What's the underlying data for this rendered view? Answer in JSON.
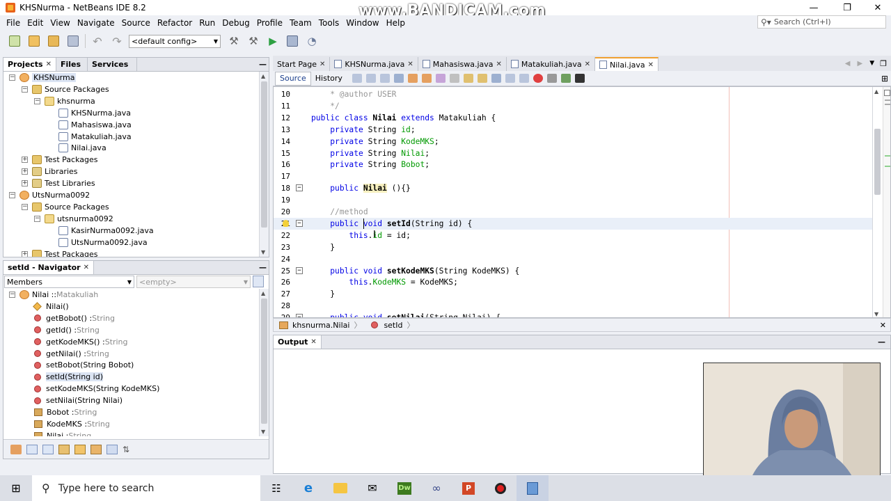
{
  "window": {
    "title": "KHSNurma - NetBeans IDE 8.2",
    "minimize": "—",
    "maximize": "❐",
    "close": "✕"
  },
  "watermark": "www.BANDICAM.com",
  "menu": [
    "File",
    "Edit",
    "View",
    "Navigate",
    "Source",
    "Refactor",
    "Run",
    "Debug",
    "Profile",
    "Team",
    "Tools",
    "Window",
    "Help"
  ],
  "search": {
    "placeholder": "Search (Ctrl+I)"
  },
  "toolbar": {
    "config": "<default config>"
  },
  "projects_panel": {
    "tabs": [
      "Projects",
      "Files",
      "Services"
    ],
    "tree": [
      {
        "label": "KHSNurma",
        "icon": "project-icon",
        "depth": 0,
        "exp": "−",
        "sel": true
      },
      {
        "label": "Source Packages",
        "icon": "package-folder-icon",
        "depth": 1,
        "exp": "−"
      },
      {
        "label": "khsnurma",
        "icon": "package-icon",
        "depth": 2,
        "exp": "−"
      },
      {
        "label": "KHSNurma.java",
        "icon": "java-file-icon",
        "depth": 3
      },
      {
        "label": "Mahasiswa.java",
        "icon": "java-file-icon",
        "depth": 3
      },
      {
        "label": "Matakuliah.java",
        "icon": "java-file-icon",
        "depth": 3
      },
      {
        "label": "Nilai.java",
        "icon": "java-file-icon",
        "depth": 3
      },
      {
        "label": "Test Packages",
        "icon": "package-folder-icon",
        "depth": 1,
        "exp": "+"
      },
      {
        "label": "Libraries",
        "icon": "library-icon",
        "depth": 1,
        "exp": "+"
      },
      {
        "label": "Test Libraries",
        "icon": "library-icon",
        "depth": 1,
        "exp": "+"
      },
      {
        "label": "UtsNurma0092",
        "icon": "project-icon",
        "depth": 0,
        "exp": "−"
      },
      {
        "label": "Source Packages",
        "icon": "package-folder-icon",
        "depth": 1,
        "exp": "−"
      },
      {
        "label": "utsnurma0092",
        "icon": "package-icon",
        "depth": 2,
        "exp": "−"
      },
      {
        "label": "KasirNurma0092.java",
        "icon": "java-file-icon",
        "depth": 3
      },
      {
        "label": "UtsNurma0092.java",
        "icon": "java-file-icon",
        "depth": 3
      },
      {
        "label": "Test Packages",
        "icon": "package-folder-icon",
        "depth": 1,
        "exp": "+"
      }
    ]
  },
  "navigator": {
    "title": "setId - Navigator",
    "members_label": "Members",
    "filter": "<empty>",
    "items": [
      {
        "name": "Nilai :: ",
        "type": "Matakuliah",
        "kind": "class",
        "exp": "−"
      },
      {
        "name": "Nilai()",
        "type": "",
        "kind": "constructor"
      },
      {
        "name": "getBobot() : ",
        "type": "String",
        "kind": "method"
      },
      {
        "name": "getId() : ",
        "type": "String",
        "kind": "method"
      },
      {
        "name": "getKodeMKS() : ",
        "type": "String",
        "kind": "method"
      },
      {
        "name": "getNilai() : ",
        "type": "String",
        "kind": "method"
      },
      {
        "name": "setBobot(String Bobot)",
        "type": "",
        "kind": "method"
      },
      {
        "name": "setId(String id)",
        "type": "",
        "kind": "method",
        "sel": true
      },
      {
        "name": "setKodeMKS(String KodeMKS)",
        "type": "",
        "kind": "method"
      },
      {
        "name": "setNilai(String Nilai)",
        "type": "",
        "kind": "method"
      },
      {
        "name": "Bobot : ",
        "type": "String",
        "kind": "field"
      },
      {
        "name": "KodeMKS : ",
        "type": "String",
        "kind": "field"
      },
      {
        "name": "Nilai : ",
        "type": "String",
        "kind": "field"
      }
    ]
  },
  "editor": {
    "tabs": [
      {
        "label": "Start Page",
        "active": false
      },
      {
        "label": "KHSNurma.java",
        "active": false
      },
      {
        "label": "Mahasiswa.java",
        "active": false
      },
      {
        "label": "Matakuliah.java",
        "active": false
      },
      {
        "label": "Nilai.java",
        "active": true
      }
    ],
    "subtabs": [
      "Source",
      "History"
    ],
    "lines": [
      {
        "n": "10",
        "segs": [
          [
            "cm",
            "    * @author USER"
          ]
        ]
      },
      {
        "n": "11",
        "segs": [
          [
            "cm",
            "    */"
          ]
        ]
      },
      {
        "n": "12",
        "segs": [
          [
            "kw",
            "public class "
          ],
          [
            "bold",
            "Nilai"
          ],
          [
            "kw",
            " extends "
          ],
          [
            "",
            "Matakuliah {"
          ]
        ]
      },
      {
        "n": "13",
        "segs": [
          [
            "",
            "    "
          ],
          [
            "kw",
            "private "
          ],
          [
            "",
            "String "
          ],
          [
            "fld",
            "id"
          ],
          [
            "",
            ";"
          ]
        ]
      },
      {
        "n": "14",
        "segs": [
          [
            "",
            "    "
          ],
          [
            "kw",
            "private "
          ],
          [
            "",
            "String "
          ],
          [
            "fld",
            "KodeMKS"
          ],
          [
            "",
            ";"
          ]
        ]
      },
      {
        "n": "15",
        "segs": [
          [
            "",
            "    "
          ],
          [
            "kw",
            "private "
          ],
          [
            "",
            "String "
          ],
          [
            "fld",
            "Nilai"
          ],
          [
            "",
            ";"
          ]
        ]
      },
      {
        "n": "16",
        "segs": [
          [
            "",
            "    "
          ],
          [
            "kw",
            "private "
          ],
          [
            "",
            "String "
          ],
          [
            "fld",
            "Bobot"
          ],
          [
            "",
            ";"
          ]
        ]
      },
      {
        "n": "17",
        "segs": [
          [
            "",
            ""
          ]
        ]
      },
      {
        "n": "18",
        "segs": [
          [
            "",
            "    "
          ],
          [
            "kw",
            "public "
          ],
          [
            "bold",
            "Nilai"
          ],
          [
            "",
            " (){}"
          ]
        ],
        "fold": true
      },
      {
        "n": "19",
        "segs": [
          [
            "",
            ""
          ]
        ]
      },
      {
        "n": "20",
        "segs": [
          [
            "cm",
            "    //method"
          ]
        ]
      },
      {
        "n": "21",
        "segs": [
          [
            "",
            "    "
          ],
          [
            "kw",
            "public void "
          ],
          [
            "bold",
            "setId"
          ],
          [
            "",
            "(String id) {"
          ]
        ],
        "fold": true,
        "hint": true,
        "current": true
      },
      {
        "n": "22",
        "segs": [
          [
            "",
            "        "
          ],
          [
            "kw",
            "this"
          ],
          [
            "",
            "."
          ],
          [
            "fld",
            "id"
          ],
          [
            "",
            " = id;"
          ]
        ]
      },
      {
        "n": "23",
        "segs": [
          [
            "",
            "    }"
          ]
        ]
      },
      {
        "n": "24",
        "segs": [
          [
            "",
            ""
          ]
        ]
      },
      {
        "n": "25",
        "segs": [
          [
            "",
            "    "
          ],
          [
            "kw",
            "public void "
          ],
          [
            "bold",
            "setKodeMKS"
          ],
          [
            "",
            "(String KodeMKS) {"
          ]
        ],
        "fold": true
      },
      {
        "n": "26",
        "segs": [
          [
            "",
            "        "
          ],
          [
            "kw",
            "this"
          ],
          [
            "",
            "."
          ],
          [
            "fld",
            "KodeMKS"
          ],
          [
            "",
            " = KodeMKS;"
          ]
        ]
      },
      {
        "n": "27",
        "segs": [
          [
            "",
            "    }"
          ]
        ]
      },
      {
        "n": "28",
        "segs": [
          [
            "",
            ""
          ]
        ]
      },
      {
        "n": "29",
        "segs": [
          [
            "",
            "    "
          ],
          [
            "kw",
            "public void "
          ],
          [
            "bold",
            "setNilai"
          ],
          [
            "",
            "(String Nilai) {"
          ]
        ],
        "fold": true
      }
    ],
    "breadcrumb": [
      "khsnurma.Nilai",
      "setId"
    ]
  },
  "output": {
    "title": "Output"
  },
  "taskbar": {
    "search": "Type here to search"
  }
}
